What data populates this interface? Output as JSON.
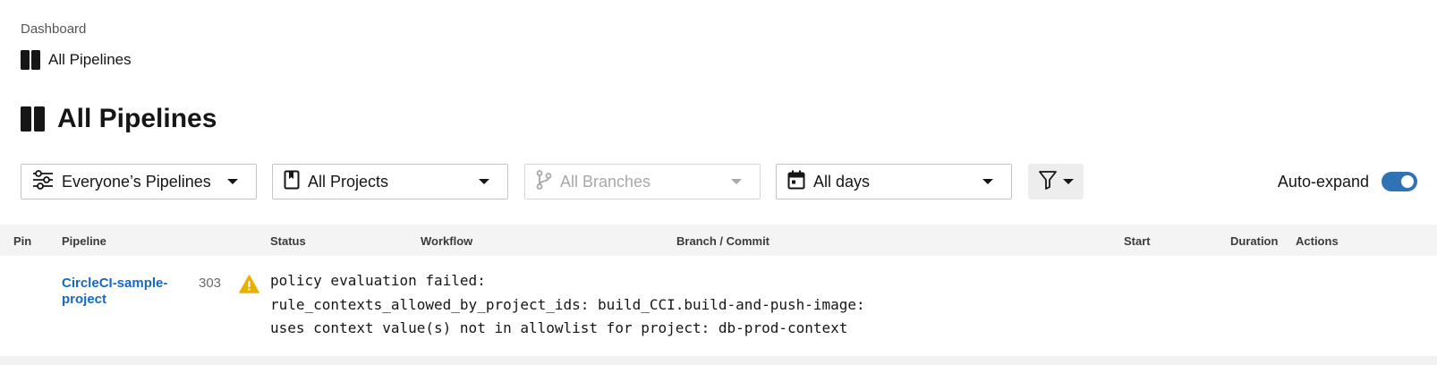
{
  "breadcrumb": {
    "parent": "Dashboard",
    "current": "All Pipelines"
  },
  "page": {
    "title": "All Pipelines"
  },
  "filters": {
    "pipelines": {
      "value": "Everyone’s Pipelines",
      "icon": "sliders-icon"
    },
    "projects": {
      "value": "All Projects",
      "icon": "bookmark-icon"
    },
    "branches": {
      "value": "All Branches",
      "icon": "git-branch-icon",
      "disabled": true
    },
    "days": {
      "value": "All days",
      "icon": "calendar-icon"
    },
    "filter_button_icon": "funnel-icon"
  },
  "auto_expand": {
    "label": "Auto-expand",
    "enabled": true
  },
  "table": {
    "headers": {
      "pin": "Pin",
      "pipeline": "Pipeline",
      "status": "Status",
      "workflow": "Workflow",
      "branch_commit": "Branch / Commit",
      "start": "Start",
      "duration": "Duration",
      "actions": "Actions"
    },
    "rows": [
      {
        "pipeline": "CircleCI-sample-project",
        "number": "303",
        "status_icon": "warning-icon",
        "status_message": "policy evaluation failed:\nrule_contexts_allowed_by_project_ids: build_CCI.build-and-push-image:\nuses context value(s) not in allowlist for project: db-prod-context"
      }
    ]
  },
  "colors": {
    "link": "#1769c2",
    "toggle_on": "#2f73b6",
    "warning": "#e8b100",
    "header_bg": "#f4f4f4"
  }
}
